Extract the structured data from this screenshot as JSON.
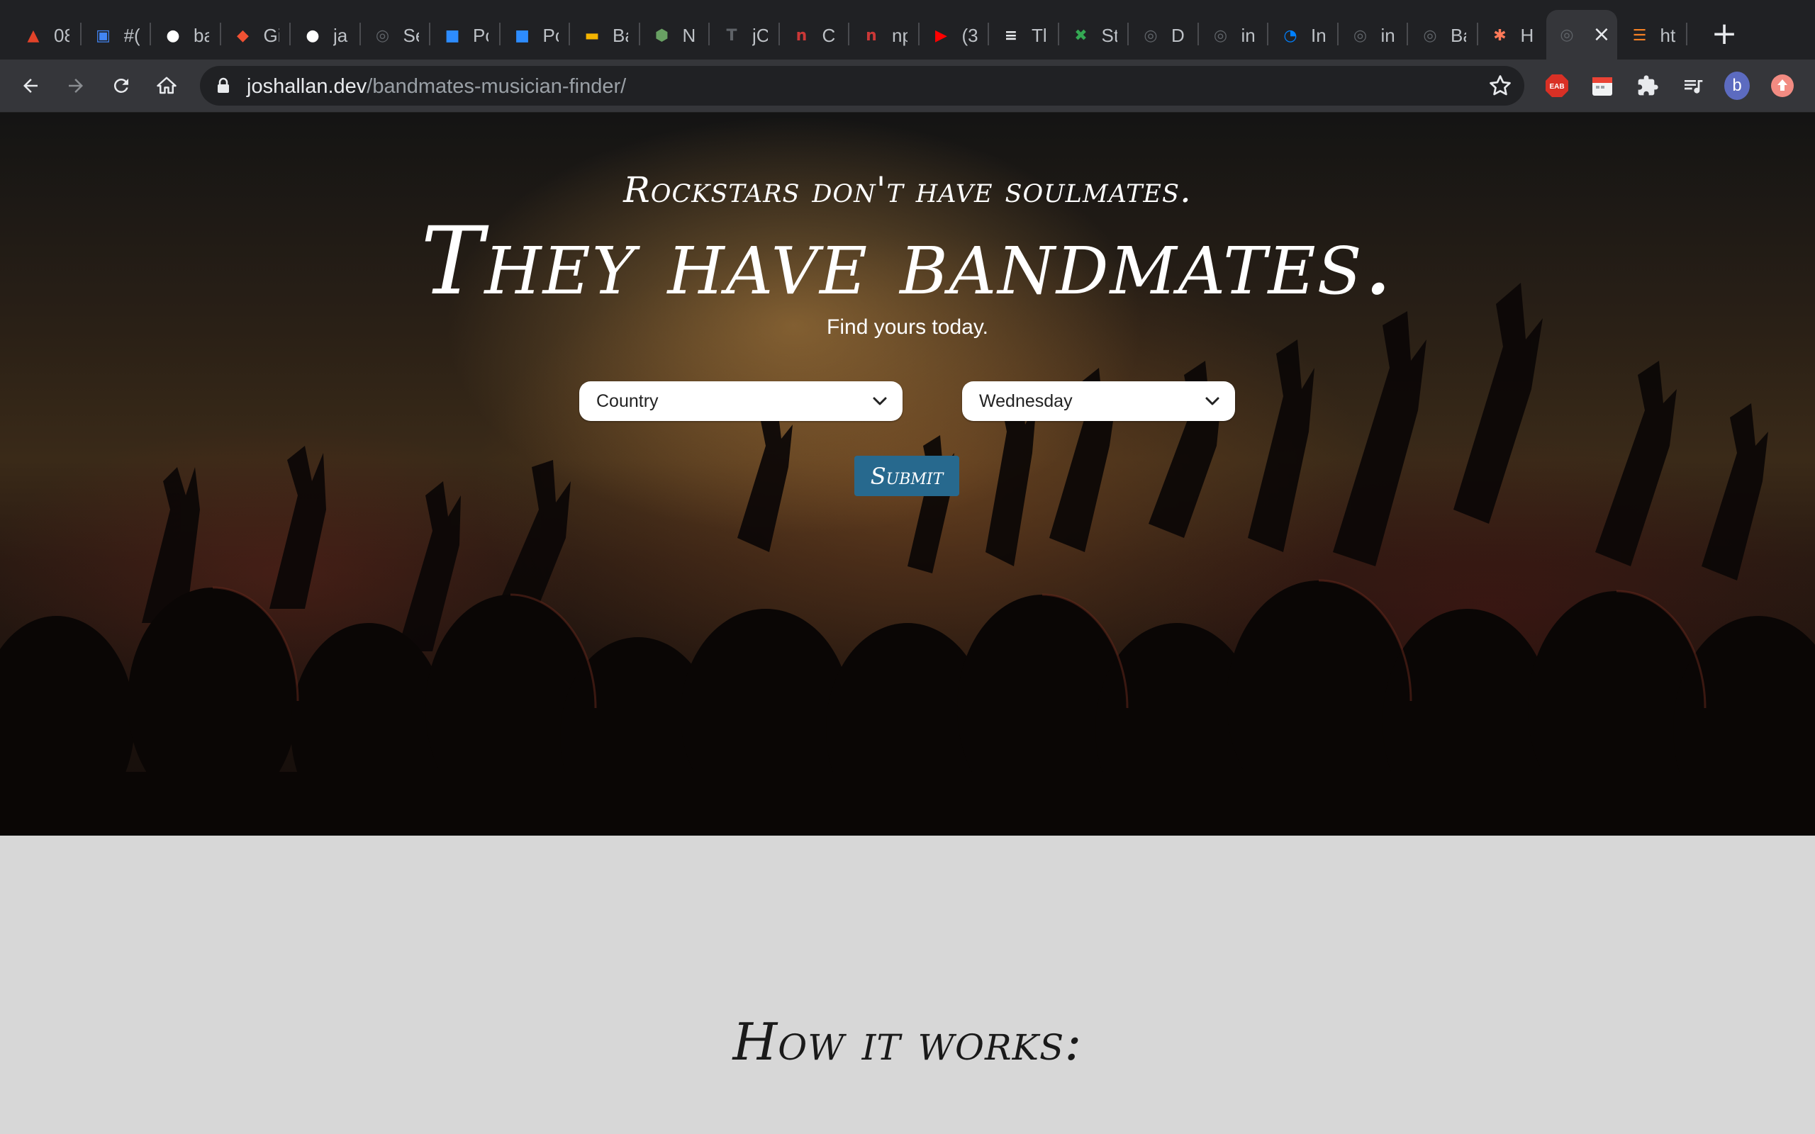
{
  "browser": {
    "tabs": [
      {
        "title": "08",
        "icon": "gitlab-icon",
        "color": "#e24329"
      },
      {
        "title": "#(",
        "icon": "calendar-icon",
        "color": "#4285f4"
      },
      {
        "title": "ba",
        "icon": "github-icon",
        "color": "#ffffff"
      },
      {
        "title": "Gi",
        "icon": "git-icon",
        "color": "#f05133"
      },
      {
        "title": "ja",
        "icon": "github-icon",
        "color": "#ffffff"
      },
      {
        "title": "Se",
        "icon": "globe-icon",
        "color": "#5f6368"
      },
      {
        "title": "Pc",
        "icon": "zoom-icon",
        "color": "#2d8cff"
      },
      {
        "title": "Pc",
        "icon": "zoom-icon",
        "color": "#2d8cff"
      },
      {
        "title": "Ba",
        "icon": "slides-icon",
        "color": "#f4b400"
      },
      {
        "title": "N",
        "icon": "node-icon",
        "color": "#68a063"
      },
      {
        "title": "jC",
        "icon": "t-icon",
        "color": "#5f6368"
      },
      {
        "title": "C",
        "icon": "npm-icon",
        "color": "#cb3837"
      },
      {
        "title": "np",
        "icon": "npm-icon",
        "color": "#cb3837"
      },
      {
        "title": "(3",
        "icon": "youtube-icon",
        "color": "#ff0000"
      },
      {
        "title": "Tl",
        "icon": "bars-icon",
        "color": "#e8eaed"
      },
      {
        "title": "St",
        "icon": "pinwheel-icon",
        "color": "#34a853"
      },
      {
        "title": "D",
        "icon": "globe-icon",
        "color": "#5f6368"
      },
      {
        "title": "in",
        "icon": "globe-icon",
        "color": "#5f6368"
      },
      {
        "title": "In",
        "icon": "digitalocean-icon",
        "color": "#0080ff"
      },
      {
        "title": "in",
        "icon": "globe-icon",
        "color": "#5f6368"
      },
      {
        "title": "Ba",
        "icon": "globe-icon",
        "color": "#5f6368"
      },
      {
        "title": "H",
        "icon": "hubspot-icon",
        "color": "#ff7a59"
      },
      {
        "title": "",
        "icon": "globe-icon",
        "color": "#5f6368",
        "active": true
      },
      {
        "title": "ht",
        "icon": "stackoverflow-icon",
        "color": "#f48024"
      }
    ],
    "url_domain": "joshallan.dev",
    "url_path": "/bandmates-musician-finder/",
    "profile_initial": "b",
    "extension_badge": "EAB"
  },
  "hero": {
    "tagline": "Rockstars don't have soulmates.",
    "headline": "They have bandmates.",
    "subline": "Find yours today.",
    "genre_select": "Country",
    "day_select": "Wednesday",
    "submit_label": "Submit"
  },
  "how": {
    "title": "How it works:"
  }
}
